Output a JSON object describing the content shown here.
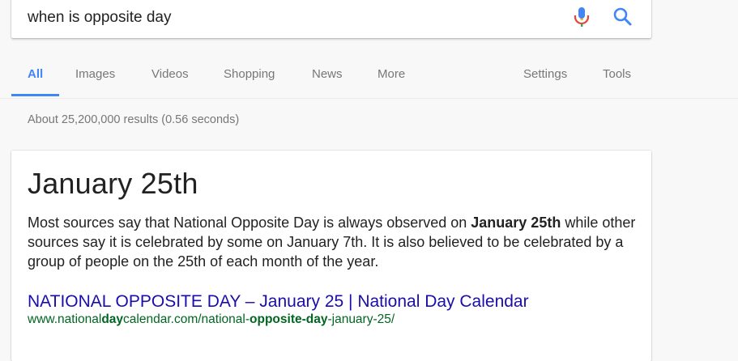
{
  "search": {
    "query": "when is opposite day",
    "mic_icon": "microphone-icon",
    "search_icon": "magnifier-icon"
  },
  "tabs": {
    "all": "All",
    "images": "Images",
    "videos": "Videos",
    "shopping": "Shopping",
    "news": "News",
    "more": "More",
    "settings": "Settings",
    "tools": "Tools"
  },
  "results_stats": "About 25,200,000 results (0.56 seconds)",
  "featured": {
    "answer": "January 25th",
    "desc_part1": "Most sources say that National Opposite Day is always observed on ",
    "desc_bold": "January 25th",
    "desc_part2": " while other sources say it is celebrated by some on January 7th. It is also believed to be celebrated by a group of people on the 25th of each month of the year.",
    "link_title": "NATIONAL OPPOSITE DAY – January 25 | National Day Calendar",
    "url": {
      "p1": "www.national",
      "b1": "day",
      "p2": "calendar.com/national-",
      "b2": "opposite-day",
      "p3": "-january-25/"
    }
  },
  "colors": {
    "accent": "#4285f4",
    "link": "#1a0dab",
    "url": "#006621",
    "muted": "#777777"
  }
}
